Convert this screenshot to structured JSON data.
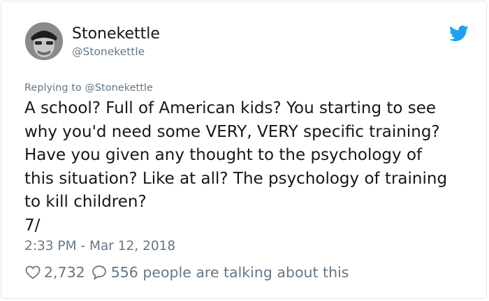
{
  "user": {
    "display_name": "Stonekettle",
    "handle": "@Stonekettle"
  },
  "tweet": {
    "replying_to": "Replying to @Stonekettle",
    "lines": [
      "A school? Full of American kids? You starting to see",
      "why you'd need some VERY, VERY specific training?",
      "Have you given any thought to the psychology of",
      "this situation? Like at all? The psychology of training",
      "to kill children?",
      "7/"
    ],
    "timestamp": "2:33 PM - Mar 12, 2018"
  },
  "engagement": {
    "likes": "2,732",
    "replies": "556 people are talking about this"
  },
  "icons": {
    "brand": "twitter-bird-icon",
    "like": "heart-icon",
    "reply": "speech-bubble-icon"
  },
  "colors": {
    "brand": "#1da1f2",
    "text": "#14171a",
    "secondary": "#657786",
    "border": "#e1e8ed"
  }
}
